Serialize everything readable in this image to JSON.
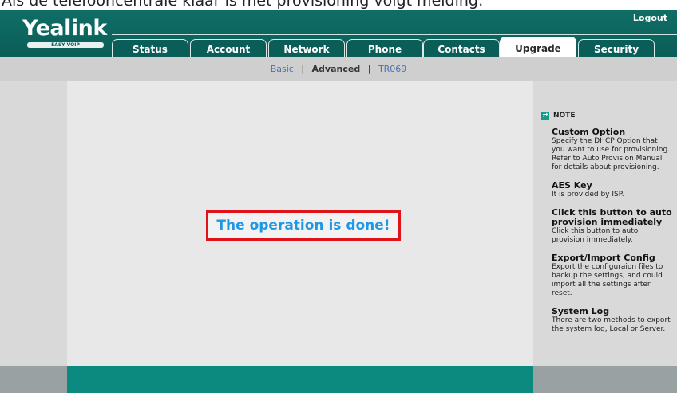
{
  "caption": "Als de telefooncentrale klaar is met provisioning volgt melding:",
  "header": {
    "logo": "Yealink",
    "logo_tagline": "EASY VOIP",
    "logout_label": "Logout"
  },
  "tabs": [
    {
      "label": "Status"
    },
    {
      "label": "Account"
    },
    {
      "label": "Network"
    },
    {
      "label": "Phone"
    },
    {
      "label": "Contacts"
    },
    {
      "label": "Upgrade",
      "active": true
    },
    {
      "label": "Security"
    }
  ],
  "subnav": {
    "basic": "Basic",
    "advanced": "Advanced",
    "tr069": "TR069",
    "separator": "|"
  },
  "main": {
    "result_message": "The operation is done!"
  },
  "notes": {
    "heading": "NOTE",
    "items": [
      {
        "title": "Custom Option",
        "desc": "Specify the DHCP Option that you want to use for provisioning. Refer to Auto Provision Manual for details about provisioning."
      },
      {
        "title": "AES Key",
        "desc": "It is provided by ISP."
      },
      {
        "title": "Click this button to auto provision immediately",
        "desc": "Click this button to auto provision immediately."
      },
      {
        "title": "Export/Import Config",
        "desc": "Export the configuraion files to backup the settings, and could import all the settings after reset."
      },
      {
        "title": "System Log",
        "desc": "There are two methods to export the system log, Local or Server."
      }
    ]
  },
  "colors": {
    "brand": "#0b5d57",
    "footer_accent": "#0d8a80",
    "message_text": "#1e98e6",
    "message_border": "#e0131a"
  }
}
